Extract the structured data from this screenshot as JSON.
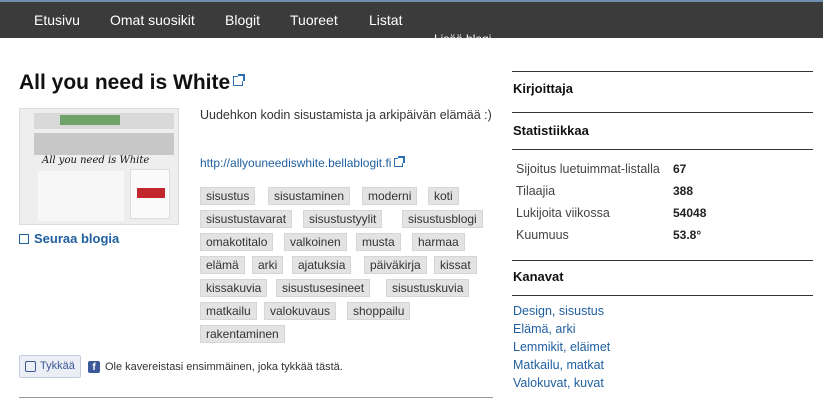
{
  "nav": {
    "items": [
      "Etusivu",
      "Omat suosikit",
      "Blogit",
      "Tuoreet",
      "Listat"
    ],
    "more_label": "Lisää blogi"
  },
  "blog": {
    "title": "All you need is White",
    "thumbnail_title": "All you need is White",
    "follow_label": "Seuraa blogia",
    "description": "Uudehkon kodin sisustamista ja arkipäivän elämää :)",
    "url": "http://allyouneediswhite.bellablogit.fi",
    "tags": [
      "sisustus",
      "sisustaminen",
      "moderni",
      "koti",
      "sisustustavarat",
      "sisustustyylit",
      "sisustusblogi",
      "omakotitalo",
      "valkoinen",
      "musta",
      "harmaa",
      "elämä",
      "arki",
      "ajatuksia",
      "päiväkirja",
      "kissat",
      "kissakuvia",
      "sisustusesineet",
      "sisustuskuvia",
      "matkailu",
      "valokuvaus",
      "shoppailu",
      "rakentaminen"
    ]
  },
  "social": {
    "like_label": "Tykkää",
    "fb_icon_text": "f",
    "friends_text": "Ole kavereistasi ensimmäinen, joka tykkää tästä."
  },
  "sidebar": {
    "author_heading": "Kirjoittaja",
    "stats_heading": "Statistiikkaa",
    "stats": [
      {
        "label": "Sijoitus luetuimmat-listalla",
        "value": "67"
      },
      {
        "label": "Tilaajia",
        "value": "388"
      },
      {
        "label": "Lukijoita viikossa",
        "value": "54048"
      },
      {
        "label": "Kuumuus",
        "value": "53.8°"
      }
    ],
    "channels_heading": "Kanavat",
    "channels": [
      "Design, sisustus",
      "Elämä, arki",
      "Lemmikit, eläimet",
      "Matkailu, matkat",
      "Valokuvat, kuvat"
    ]
  }
}
